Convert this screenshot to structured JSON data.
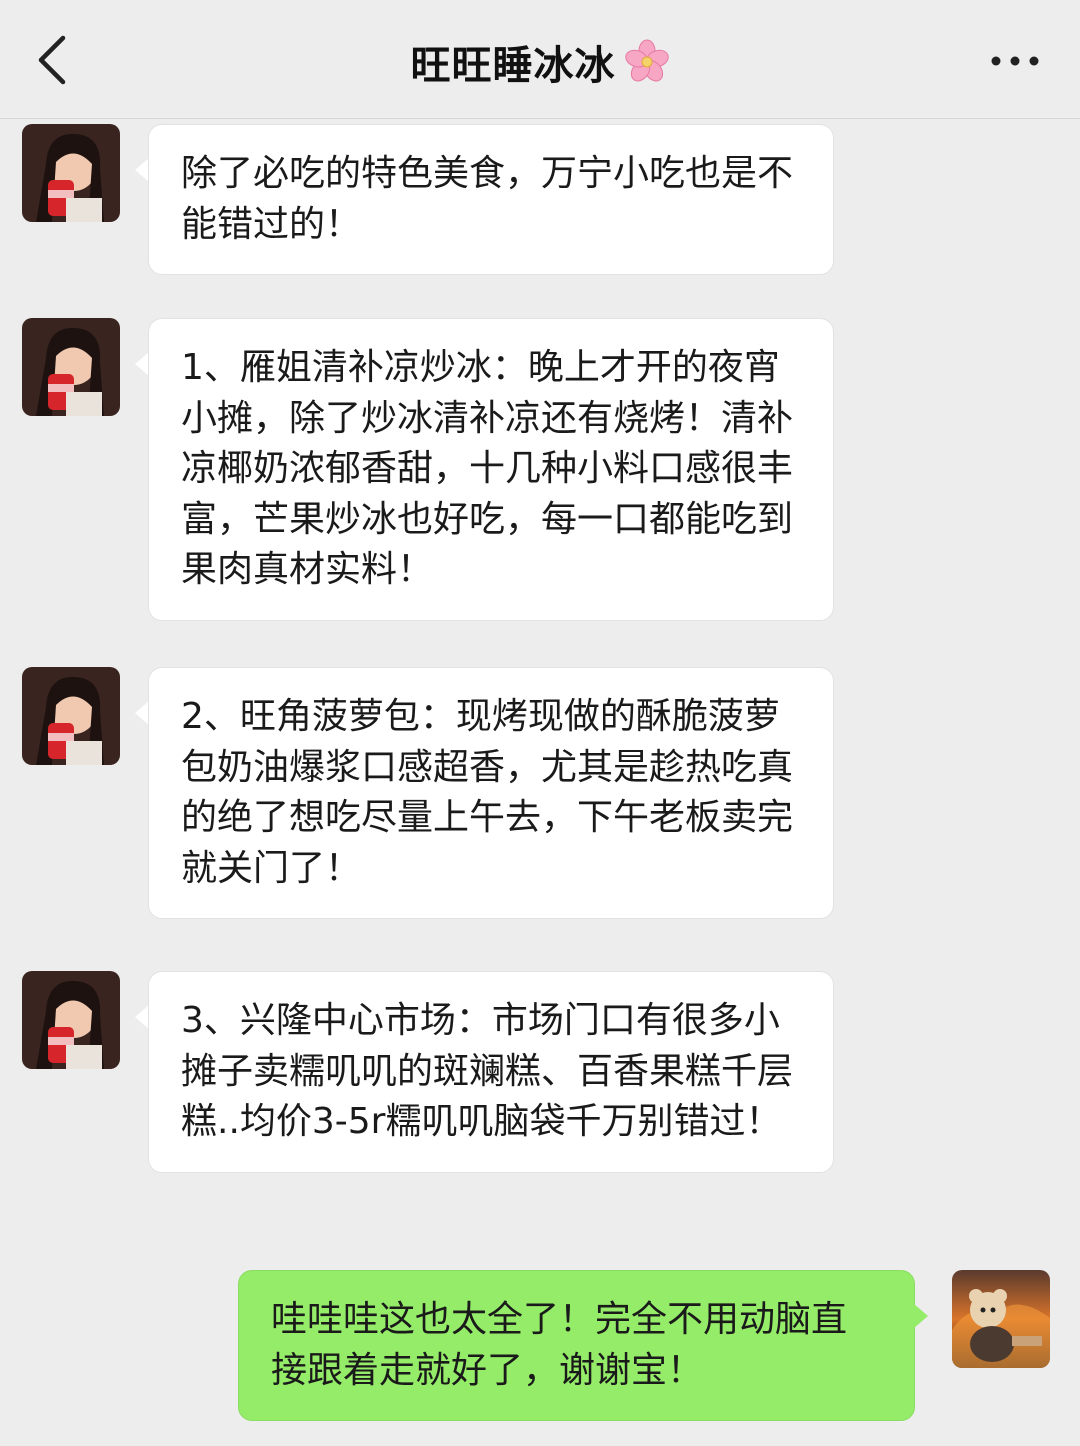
{
  "header": {
    "title": "旺旺睡冰冰",
    "back_icon": "chevron-left-icon",
    "title_emoji": "cherry-blossom-icon",
    "more_icon": "more-dots-icon"
  },
  "colors": {
    "background": "#ededed",
    "incoming_bubble": "#ffffff",
    "outgoing_bubble": "#95ec69"
  },
  "messages": [
    {
      "sender": "other",
      "text": "除了必吃的特色美食，万宁小吃也是不能错过的！"
    },
    {
      "sender": "other",
      "text": "1、雁姐清补凉炒冰：晚上才开的夜宵小摊，除了炒冰清补凉还有烧烤！清补凉椰奶浓郁香甜，十几种小料口感很丰富，芒果炒冰也好吃，每一口都能吃到果肉真材实料！"
    },
    {
      "sender": "other",
      "text": "2、旺角菠萝包：现烤现做的酥脆菠萝包奶油爆浆口感超香，尤其是趁热吃真的绝了想吃尽量上午去，下午老板卖完就关门了！"
    },
    {
      "sender": "other",
      "text": "3、兴隆中心市场：市场门口有很多小摊子卖糯叽叽的斑斓糕、百香果糕千层糕..均价3-5r糯叽叽脑袋千万别错过！"
    },
    {
      "sender": "me",
      "text": "哇哇哇这也太全了！完全不用动脑直接跟着走就好了，谢谢宝！"
    }
  ]
}
